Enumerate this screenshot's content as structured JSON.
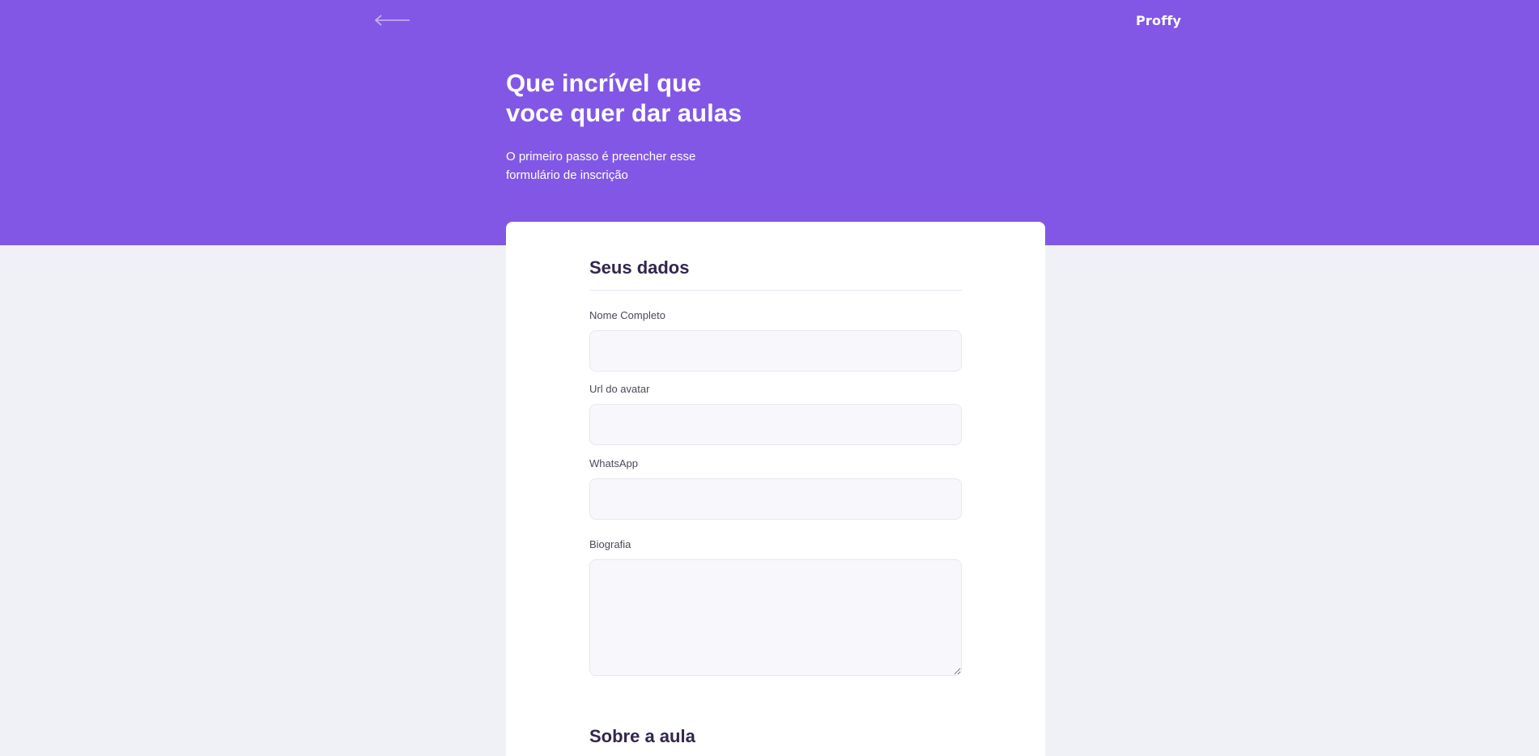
{
  "header": {
    "back_icon": "arrow-left-icon",
    "logo_text": "Proffy"
  },
  "hero": {
    "title_line1": "Que incrível que",
    "title_line2": "voce quer dar aulas",
    "subtitle_line1": "O primeiro passo é preencher esse",
    "subtitle_line2": "formulário de inscrição"
  },
  "form": {
    "section_personal": "Seus dados",
    "fields": {
      "name_label": "Nome Completo",
      "name_value": "",
      "avatar_label": "Url do avatar",
      "avatar_value": "",
      "whatsapp_label": "WhatsApp",
      "whatsapp_value": "",
      "bio_label": "Biografia",
      "bio_value": ""
    },
    "section_class": "Sobre a aula"
  },
  "colors": {
    "primary": "#8257e5",
    "background": "#f0f0f7",
    "card": "#ffffff",
    "title_text": "#32264d",
    "input_bg": "#f8f8fc",
    "input_border": "#e6e6f0"
  }
}
